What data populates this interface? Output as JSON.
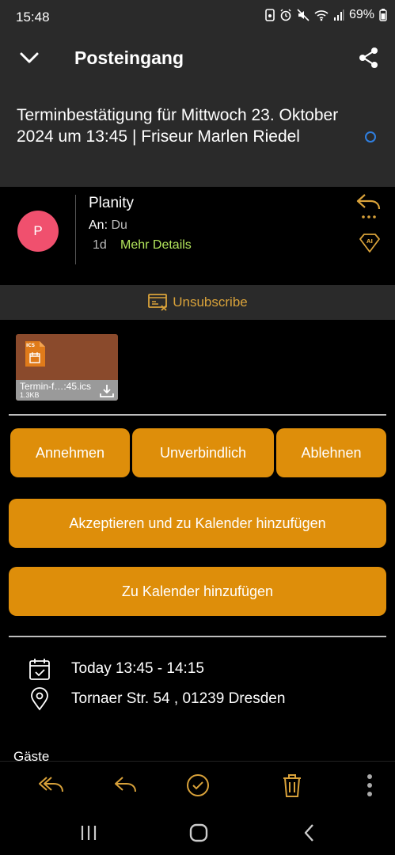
{
  "status_bar": {
    "time": "15:48",
    "battery": "69%",
    "icons": [
      "screen-record-icon",
      "alarm-icon",
      "mute-icon",
      "wifi-icon",
      "signal-icon",
      "battery-icon"
    ]
  },
  "header": {
    "title": "Posteingang",
    "subject": "Terminbestätigung für Mittwoch 23. Oktober 2024 um 13:45 | Friseur Marlen Riedel"
  },
  "sender": {
    "avatar_letter": "P",
    "name": "Planity",
    "to_label": "An:",
    "to_value": "Du",
    "time": "1d",
    "more_details": "Mehr Details"
  },
  "unsubscribe": {
    "label": "Unsubscribe"
  },
  "attachment": {
    "type_badge": "ICS",
    "filename": "Termin-f…:45.ics",
    "size": "1.3KB"
  },
  "rsvp": {
    "accept": "Annehmen",
    "tentative": "Unverbindlich",
    "decline": "Ablehnen",
    "accept_and_add": "Akzeptieren und zu Kalender hinzufügen",
    "add_to_calendar": "Zu Kalender hinzufügen"
  },
  "event": {
    "time": "Today 13:45 - 14:15",
    "location": "Tornaer Str. 54 , 01239 Dresden"
  },
  "guests_label": "Gäste",
  "colors": {
    "accent": "#de8e0a",
    "header_bg": "#2a2a2a",
    "link_green": "#b3e65c",
    "avatar": "#f0506e",
    "icon_orange": "#d9a23a"
  }
}
